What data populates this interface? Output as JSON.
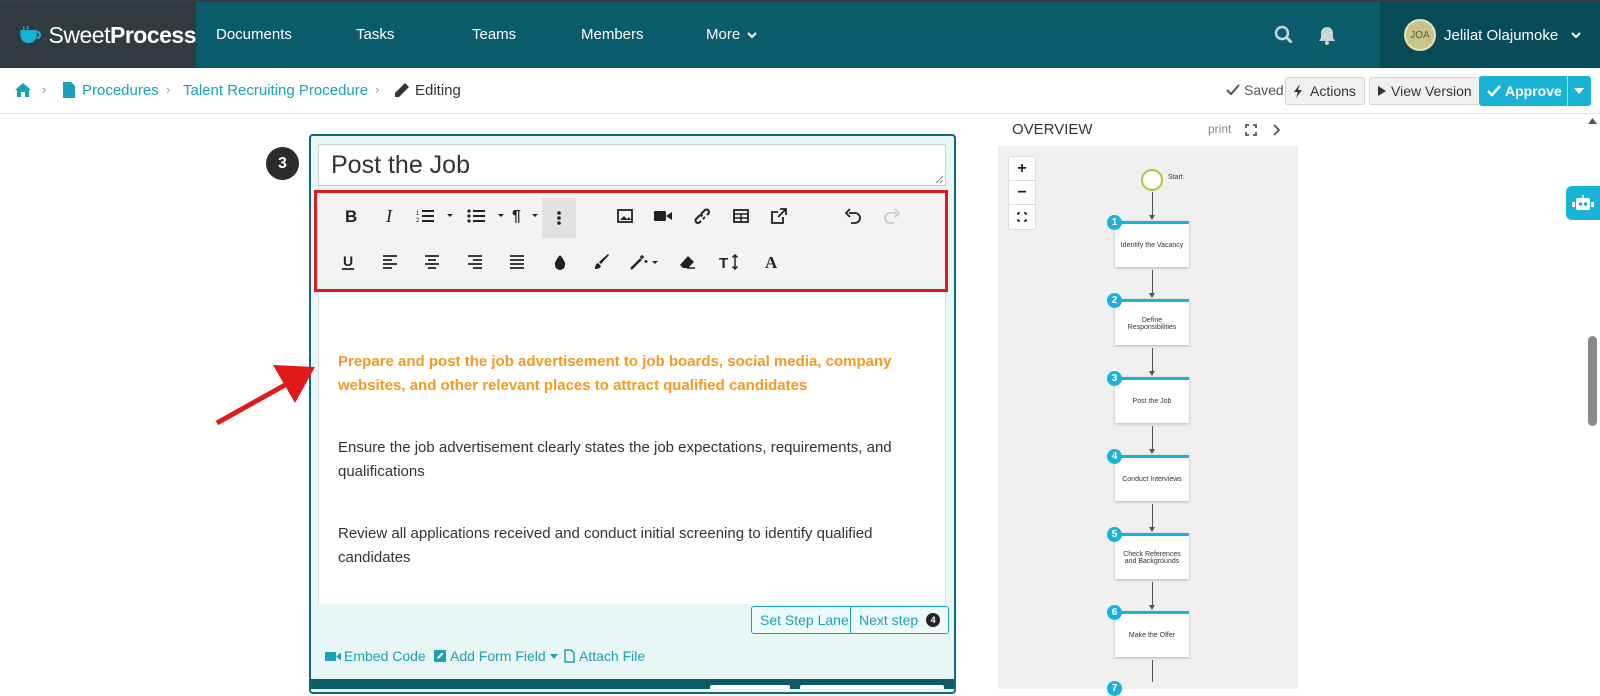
{
  "header": {
    "logo_light": "Sweet",
    "logo_bold": "Process",
    "nav": [
      "Documents",
      "Tasks",
      "Teams",
      "Members",
      "More"
    ],
    "user_name": "Jelilat Olajumoke",
    "avatar_text": "JOA"
  },
  "breadcrumb": {
    "procedures": "Procedures",
    "procedure_name": "Talent Recruiting Procedure",
    "editing": "Editing"
  },
  "actions": {
    "saved": "Saved",
    "actions_label": "Actions",
    "view_version": "View Version",
    "approve": "Approve"
  },
  "step": {
    "number": "3",
    "title": "Post the Job",
    "paragraphs": [
      "Prepare and post the job advertisement to job boards, social media, company websites, and other relevant places to attract qualified candidates",
      "Ensure the job advertisement clearly states the job expectations, requirements, and qualifications",
      "Review all applications received and conduct initial screening to identify qualified candidates"
    ],
    "set_step_lane": "Set Step Lane",
    "next_step": "Next step",
    "next_step_num": "4",
    "embed_code": "Embed Code",
    "add_form_field": "Add Form Field",
    "attach_file": "Attach File"
  },
  "overview": {
    "title": "OVERVIEW",
    "print": "print",
    "start": "Start",
    "nodes": [
      {
        "num": "1",
        "label": "Identify the Vacancy"
      },
      {
        "num": "2",
        "label": "Define Responsibilities"
      },
      {
        "num": "3",
        "label": "Post the Job"
      },
      {
        "num": "4",
        "label": "Conduct Interviews"
      },
      {
        "num": "5",
        "label": "Check References and Backgrounds"
      },
      {
        "num": "6",
        "label": "Make the Offer"
      },
      {
        "num": "7",
        "label": ""
      }
    ]
  },
  "colors": {
    "topbar": "#0a5b6b",
    "accent": "#1ab2d6",
    "highlight_text": "#f39a22",
    "annotation_red": "#e01a1a"
  }
}
